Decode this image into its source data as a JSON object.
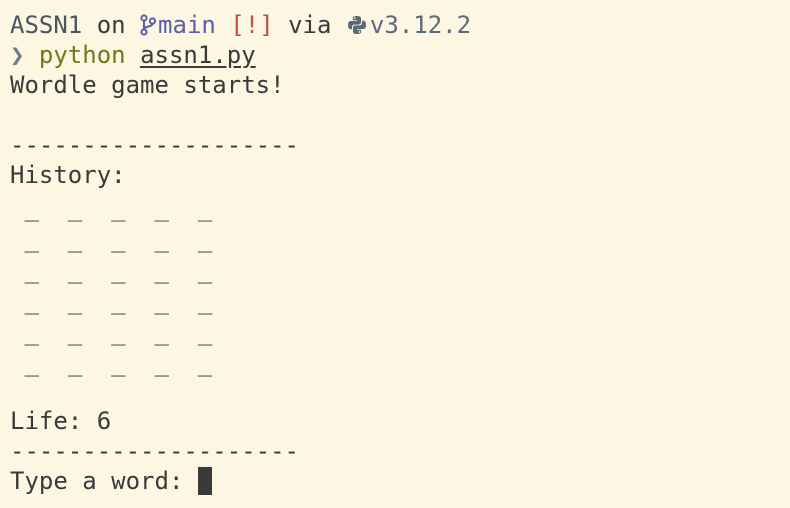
{
  "prompt": {
    "dir": "ASSN1",
    "on_text": " on ",
    "branch_icon": "git-branch-icon",
    "branch": "main",
    "status": "[!]",
    "via_text": " via ",
    "python_icon": "python-icon",
    "python_version": "v3.12.2"
  },
  "command": {
    "chevron": "❯",
    "program": "python",
    "argument": "assn1.py"
  },
  "output": {
    "start_message": "Wordle game starts!",
    "divider": "--------------------",
    "history_label": "History:",
    "history_rows": [
      " _  _  _  _  _",
      " _  _  _  _  _",
      " _  _  _  _  _",
      " _  _  _  _  _",
      " _  _  _  _  _",
      " _  _  _  _  _"
    ],
    "life_text": "Life: 6",
    "input_prompt": "Type a word: "
  },
  "colors": {
    "background": "#fcf6e3",
    "text": "#3a3a3a",
    "branch": "#5a5fa6",
    "status": "#c0533a",
    "command": "#6f7a14"
  }
}
